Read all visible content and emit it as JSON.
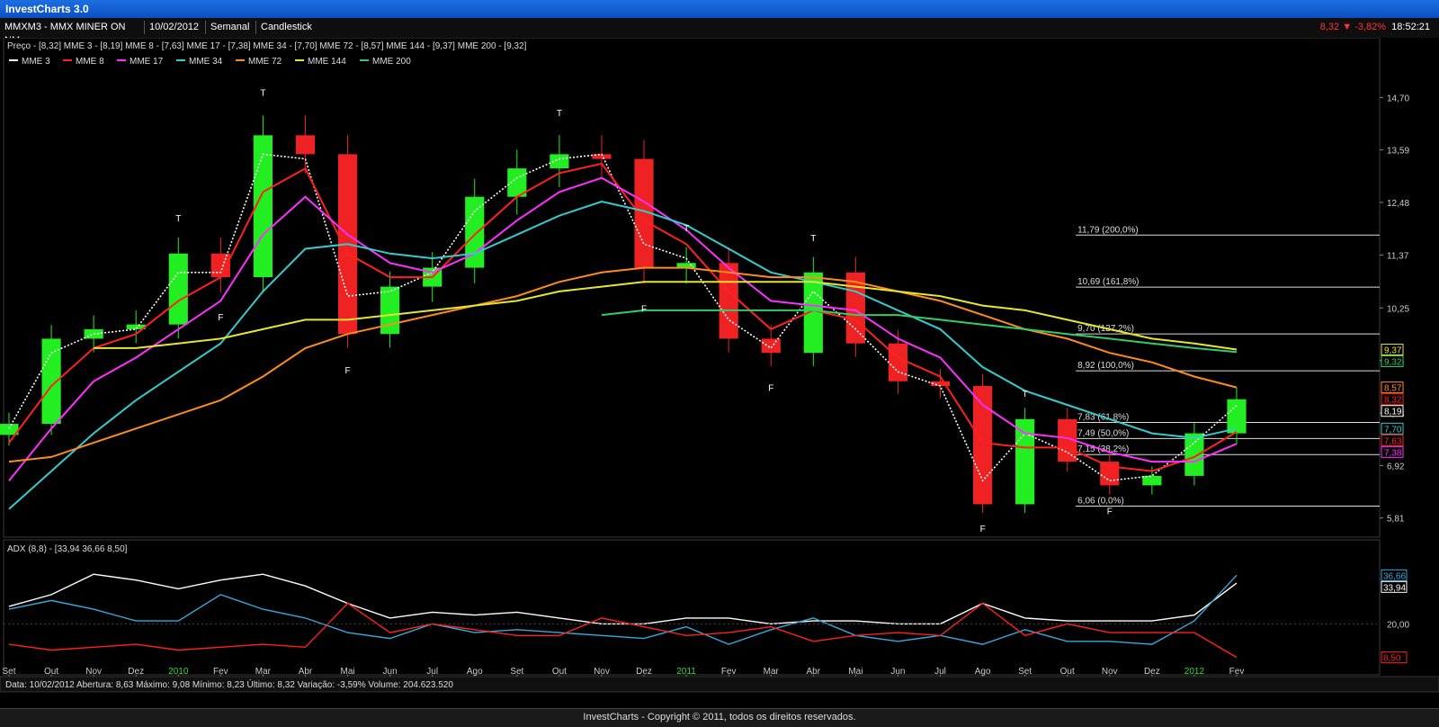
{
  "app": {
    "title": "InvestCharts 3.0"
  },
  "toolbar": {
    "symbol": "MMXM3 - MMX MINER ON NM",
    "date": "10/02/2012",
    "period": "Semanal",
    "chart_style": "Candlestick"
  },
  "readout": {
    "price": "8,32",
    "arrow": "▼",
    "change": "-3,82%",
    "time": "18:52:21"
  },
  "main_panel": {
    "header": "Preço - [8,32]   MME 3 - [8,19]   MME 8 - [7,63]   MME 17 - [7,38]   MME 34 - [7,70]   MME 72 - [8,57]   MME 144 - [9,37]   MME 200 - [9,32]",
    "legend": [
      {
        "name": "MME 3",
        "color": "#ffffff"
      },
      {
        "name": "MME 8",
        "color": "#ff2020"
      },
      {
        "name": "MME 17",
        "color": "#ff30ff"
      },
      {
        "name": "MME 34",
        "color": "#33cccc"
      },
      {
        "name": "MME 72",
        "color": "#ff8c1a"
      },
      {
        "name": "MME 144",
        "color": "#e6e62e"
      },
      {
        "name": "MME 200",
        "color": "#33cc66"
      }
    ],
    "yticks": [
      "14,70",
      "13,59",
      "12,48",
      "11,37",
      "10,25",
      "9,14",
      "8,03",
      "6,92",
      "5,81"
    ],
    "badges": [
      {
        "text": "9,37",
        "color": "#e6e62e"
      },
      {
        "text": "9,32",
        "color": "#33cc66"
      },
      {
        "text": "8,57",
        "color": "#ff8c1a"
      },
      {
        "text": "8,32",
        "color": "#ff2020"
      },
      {
        "text": "8,19",
        "color": "#ffffff"
      },
      {
        "text": "7,70",
        "color": "#33cccc"
      },
      {
        "text": "7,63",
        "color": "#ff2020"
      },
      {
        "text": "7,38",
        "color": "#ff30ff"
      }
    ],
    "fibo": [
      {
        "label": "11,79 (200,0%)",
        "value": 11.79
      },
      {
        "label": "10,69 (161,8%)",
        "value": 10.69
      },
      {
        "label": "9,70 (127,2%)",
        "value": 9.7
      },
      {
        "label": "8,92 (100,0%)",
        "value": 8.92
      },
      {
        "label": "7,83 (61,8%)",
        "value": 7.83
      },
      {
        "label": "7,49 (50,0%)",
        "value": 7.49
      },
      {
        "label": "7,15 (38,2%)",
        "value": 7.15
      },
      {
        "label": "6,06 (0,0%)",
        "value": 6.06
      }
    ],
    "markers": [
      "T",
      "T",
      "T",
      "T",
      "T",
      "T",
      "T",
      "T",
      "T",
      "F",
      "F",
      "F",
      "F",
      "F",
      "F",
      "F",
      "F",
      "F"
    ]
  },
  "adx_panel": {
    "header": "ADX (8,8) - [33,94  36,66  8,50]",
    "yticks": [
      "20,00"
    ],
    "badges": [
      {
        "text": "36,66",
        "color": "#33aadd"
      },
      {
        "text": "33,94",
        "color": "#ffffff"
      },
      {
        "text": "8,50",
        "color": "#ff2020"
      }
    ]
  },
  "xaxis": {
    "labels": [
      "Set",
      "Out",
      "Nov",
      "Dez",
      "2010",
      "Fev",
      "Mar",
      "Abr",
      "Mai",
      "Jun",
      "Jul",
      "Ago",
      "Set",
      "Out",
      "Nov",
      "Dez",
      "2011",
      "Fev",
      "Mar",
      "Abr",
      "Mai",
      "Jun",
      "Jul",
      "Ago",
      "Set",
      "Out",
      "Nov",
      "Dez",
      "2012",
      "Fev"
    ],
    "year_color": "#33dd33"
  },
  "statusbar": {
    "text": "Data: 10/02/2012   Abertura: 8,63   Máximo: 9,08   Mínimo: 8,23   Último: 8,32   Variação: -3,59%   Volume: 204.623.520"
  },
  "footer": {
    "text": "InvestCharts - Copyright © 2011, todos os direitos reservados."
  },
  "chart_data": {
    "type": "line",
    "title": "",
    "x": [
      "2009-09",
      "2009-10",
      "2009-11",
      "2009-12",
      "2010-01",
      "2010-02",
      "2010-03",
      "2010-04",
      "2010-05",
      "2010-06",
      "2010-07",
      "2010-08",
      "2010-09",
      "2010-10",
      "2010-11",
      "2010-12",
      "2011-01",
      "2011-02",
      "2011-03",
      "2011-04",
      "2011-05",
      "2011-06",
      "2011-07",
      "2011-08",
      "2011-09",
      "2011-10",
      "2011-11",
      "2011-12",
      "2012-01",
      "2012-02"
    ],
    "price_close": [
      7.8,
      9.6,
      9.8,
      9.9,
      11.4,
      10.9,
      13.9,
      13.5,
      9.7,
      10.7,
      11.1,
      12.6,
      13.2,
      13.5,
      13.4,
      11.1,
      11.2,
      9.6,
      9.3,
      11.0,
      9.5,
      8.7,
      8.6,
      6.1,
      7.9,
      7.0,
      6.5,
      6.7,
      7.6,
      8.32
    ],
    "series": [
      {
        "name": "MME 3",
        "values": [
          7.7,
          9.3,
          9.7,
          9.8,
          11.0,
          11.0,
          13.5,
          13.4,
          10.5,
          10.6,
          11.0,
          12.3,
          13.0,
          13.4,
          13.5,
          11.6,
          11.3,
          10.0,
          9.4,
          10.6,
          9.8,
          8.9,
          8.6,
          6.6,
          7.6,
          7.2,
          6.6,
          6.7,
          7.4,
          8.19
        ]
      },
      {
        "name": "MME 8",
        "values": [
          7.4,
          8.6,
          9.4,
          9.7,
          10.4,
          10.9,
          12.7,
          13.2,
          11.4,
          10.9,
          10.9,
          11.8,
          12.6,
          13.1,
          13.3,
          12.1,
          11.6,
          10.6,
          9.8,
          10.2,
          10.0,
          9.2,
          8.8,
          7.4,
          7.3,
          7.3,
          6.9,
          6.8,
          7.1,
          7.63
        ]
      },
      {
        "name": "MME 17",
        "values": [
          6.6,
          7.7,
          8.7,
          9.2,
          9.8,
          10.4,
          11.8,
          12.6,
          11.8,
          11.2,
          11.0,
          11.4,
          12.1,
          12.7,
          13.0,
          12.5,
          11.9,
          11.1,
          10.4,
          10.3,
          10.2,
          9.6,
          9.2,
          8.2,
          7.6,
          7.5,
          7.2,
          7.0,
          7.0,
          7.38
        ]
      },
      {
        "name": "MME 34",
        "values": [
          6.0,
          6.8,
          7.6,
          8.3,
          8.9,
          9.5,
          10.6,
          11.5,
          11.6,
          11.4,
          11.3,
          11.4,
          11.8,
          12.2,
          12.5,
          12.3,
          12.0,
          11.5,
          11.0,
          10.8,
          10.6,
          10.2,
          9.8,
          9.0,
          8.5,
          8.2,
          7.9,
          7.6,
          7.5,
          7.7
        ]
      },
      {
        "name": "MME 72",
        "values": [
          7.0,
          7.1,
          7.4,
          7.7,
          8.0,
          8.3,
          8.8,
          9.4,
          9.7,
          9.9,
          10.1,
          10.3,
          10.5,
          10.8,
          11.0,
          11.1,
          11.1,
          11.0,
          10.9,
          10.9,
          10.8,
          10.6,
          10.4,
          10.1,
          9.8,
          9.6,
          9.3,
          9.1,
          8.8,
          8.57
        ]
      },
      {
        "name": "MME 144",
        "values": [
          null,
          null,
          9.4,
          9.4,
          9.5,
          9.6,
          9.8,
          10.0,
          10.0,
          10.1,
          10.2,
          10.3,
          10.4,
          10.6,
          10.7,
          10.8,
          10.8,
          10.8,
          10.8,
          10.8,
          10.7,
          10.6,
          10.5,
          10.3,
          10.2,
          10.0,
          9.8,
          9.6,
          9.5,
          9.37
        ]
      },
      {
        "name": "MME 200",
        "values": [
          null,
          null,
          null,
          null,
          null,
          null,
          null,
          null,
          null,
          null,
          null,
          null,
          null,
          null,
          10.1,
          10.2,
          10.2,
          10.2,
          10.2,
          10.2,
          10.1,
          10.1,
          10.0,
          9.9,
          9.8,
          9.7,
          9.6,
          9.5,
          9.4,
          9.32
        ]
      }
    ],
    "ylim": [
      5.5,
      15.2
    ],
    "ylabel": "",
    "adx": {
      "ylim": [
        5,
        42
      ],
      "series": [
        {
          "name": "ADX",
          "values": [
            26,
            30,
            37,
            35,
            32,
            35,
            37,
            33,
            27,
            22,
            24,
            23,
            24,
            22,
            20,
            20,
            22,
            22,
            20,
            21,
            21,
            20,
            20,
            27,
            22,
            21,
            21,
            21,
            23,
            33.94
          ]
        },
        {
          "name": "+DI",
          "values": [
            25,
            28,
            25,
            21,
            21,
            30,
            25,
            22,
            17,
            15,
            20,
            17,
            18,
            17,
            16,
            15,
            19,
            13,
            18,
            22,
            16,
            14,
            16,
            13,
            18,
            14,
            14,
            13,
            21,
            36.66
          ]
        },
        {
          "name": "-DI",
          "values": [
            13,
            11,
            12,
            13,
            11,
            12,
            13,
            12,
            27,
            17,
            20,
            18,
            16,
            16,
            22,
            19,
            16,
            17,
            19,
            14,
            16,
            17,
            16,
            27,
            16,
            20,
            17,
            17,
            17,
            8.5
          ]
        }
      ]
    }
  }
}
